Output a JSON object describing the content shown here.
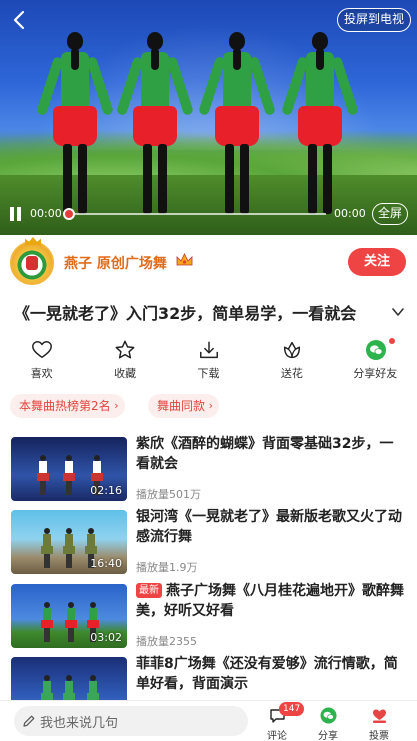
{
  "player": {
    "cast_label": "投屏到电视",
    "current_time": "00:00",
    "total_time": "00:00",
    "fullscreen_label": "全屏",
    "progress": 0
  },
  "author": {
    "name": "燕子 原创广场舞",
    "follow_label": "关注"
  },
  "video": {
    "title": "《一晃就老了》入门32步，简单易学，一看就会"
  },
  "actions": [
    {
      "label": "喜欢",
      "icon": "heart-icon"
    },
    {
      "label": "收藏",
      "icon": "star-icon"
    },
    {
      "label": "下载",
      "icon": "download-icon"
    },
    {
      "label": "送花",
      "icon": "flower-icon"
    },
    {
      "label": "分享好友",
      "icon": "wechat-icon"
    }
  ],
  "tags": [
    {
      "label": "本舞曲热榜第2名"
    },
    {
      "label": "舞曲同款"
    }
  ],
  "related": [
    {
      "title": "紫欣《酒醉的蝴蝶》背面零基础32步，一看就会",
      "duration": "02:16",
      "views": "播放量501万",
      "badge": ""
    },
    {
      "title": "银河湾《一晃就老了》最新版老歌又火了动感流行舞",
      "duration": "16:40",
      "views": "播放量1.9万",
      "badge": ""
    },
    {
      "title": "燕子广场舞《八月桂花遍地开》歌醉舞美，好听又好看",
      "duration": "03:02",
      "views": "播放量2355",
      "badge": "最新"
    },
    {
      "title": "菲菲8广场舞《还没有爱够》流行情歌，简单好看，背面演示",
      "duration": "",
      "views": "",
      "badge": ""
    }
  ],
  "bottom": {
    "comment_placeholder": "我也来说几句",
    "comment_label": "评论",
    "comment_count": "147",
    "share_label": "分享",
    "vote_label": "投票"
  },
  "colors": {
    "accent": "#ef4444",
    "author_name": "#e06c1b",
    "wechat": "#2cb34d"
  }
}
